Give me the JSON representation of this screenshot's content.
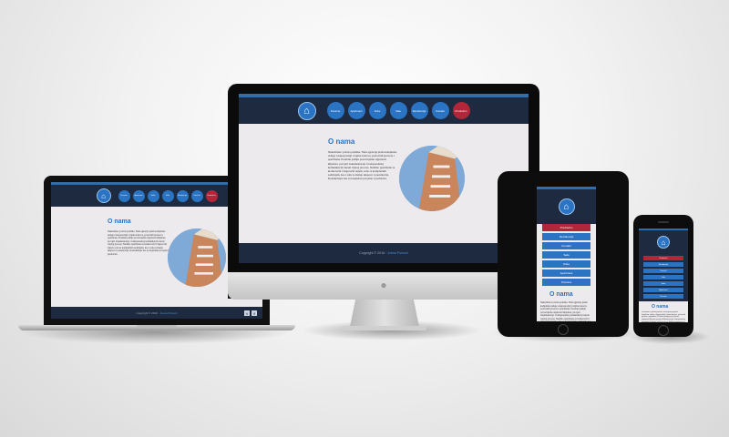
{
  "site": {
    "nav_items": [
      "Pocetna",
      "Apartmani",
      "Sobe",
      "Sala",
      "Rezidencija",
      "Kontakt",
      "Predračun"
    ],
    "active_label": "Predračun",
    "heading": "O nama",
    "body_text": "Nekretnine i pravna podrška. Naša agencija pruža kompletne usluge u kupoprodaji i najmu stanova, poslovnih prostora i apartmana. Posebnu pažnju posvećujemo sigurnosti klijenata, provjeri dokumentacije i transparentnoj komunikaciji tokom cijelog procesa. Nudimo apartmane za kratkoročni i dugoročni najam, sobe sa kompletnim sadržajem, kao i salu za manje skupove i prezentacije. Kontaktirajte nas za besplatnu procjenu i predračun.",
    "footer_copyright": "Copyright © 2016 ·",
    "footer_brand": "Arena Pomoći",
    "social": [
      "t",
      "f"
    ]
  },
  "colors": {
    "nav_bg": "#1d2a3f",
    "nav_button": "#2b74c4",
    "active_button": "#b3263a",
    "heading": "#2b74c4",
    "page_bg": "#eceaec"
  },
  "icons": {
    "logo": "house-logo-icon",
    "twitter": "twitter-icon",
    "facebook": "facebook-icon",
    "apple": "apple-logo-icon"
  }
}
